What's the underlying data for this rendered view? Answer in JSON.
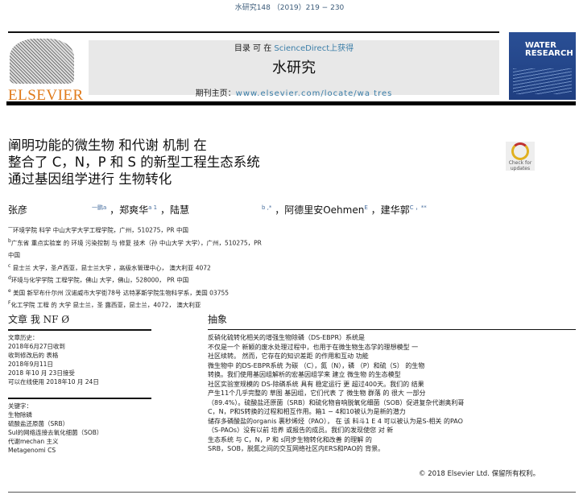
{
  "citation": "水研究148 （2019）219 − 230",
  "header": {
    "available_prefix": "目录 可 在 ",
    "available_link": "ScienceDirect上获得",
    "journal_name": "水研究",
    "homepage_prefix": "期刊主页：",
    "homepage_link": "www.elsevier.com/locate/wa tres",
    "publisher": "ELSEVIER",
    "cover_title": "WATER RESEARCH"
  },
  "crossmark": "Check for updates",
  "title_lines": [
    "阐明功能的微生物 和代谢 机制 在",
    "整合了 C，N，P  和 S   的新型工程生态系统",
    "通过基因组学进行  生物转化"
  ],
  "authors": [
    {
      "name": "张彦",
      "sup": "一鹏a"
    },
    {
      "name": "，郑爽华",
      "sup": "a 1"
    },
    {
      "name": "，陆慧",
      "sup": "b ,*"
    },
    {
      "name": "，阿德里安Oehmen",
      "sup": "E"
    },
    {
      "name": "，建华郭",
      "sup": "C ，**"
    }
  ],
  "affiliations": [
    {
      "sup": "一",
      "text": "环境学院 科学 中山大学大学工程学院，广州，510275，PR 中国"
    },
    {
      "sup": "b",
      "text": "广东省 重点实验室 的 环境 污染控制 与 修复 技术（孙 中山大学 大学），广州，510275，PR"
    },
    {
      "sup": "",
      "text": "中国"
    },
    {
      "sup": "c",
      "text": " 昆士兰 大学，圣卢西亚，昆士兰大学 ，高级水管理中心， 澳大利亚   4072"
    },
    {
      "sup": "d",
      "text": "环境与化学学院 工程学院，佛山 大学，佛山，528000， PR 中国"
    },
    {
      "sup": "e",
      "text": " 美国 新罕布什尔州 汉诺威市大学街78号 达特茅斯学院生物科学系，美国   03755"
    },
    {
      "sup": "F",
      "text": "化工学院 工程 的 大学 昆士兰，圣 露西亚，昆士兰，4072， 澳大利亚"
    }
  ],
  "article_info": {
    "heading": "文章 我 NF  Ø",
    "history_label": "文章历史：",
    "history": [
      "2018年6月27日收到",
      "收到修改后的 表格",
      "2018年9月11日",
      " 2018 年10 月   23日接受",
      "可以在线使用 2018年10 月   24日"
    ],
    "keywords_label": "关键字：",
    "keywords": [
      "生物除磷",
      "硫酸盐还原菌（SRB）",
      "Sul的网络连接去氧化细菌（SOB）",
      "代谢mechan 主义",
      "Metagenomi CS"
    ]
  },
  "abstract": {
    "heading": "抽象",
    "lines": [
      "反硝化硫转化相关的增强生物除磷（DS-EBPR）系统是",
      "不仅是一个 新颖的废水处理过程中，也用于在微生物生态学的理想模型 一",
      "社区续转。 然而，它存在的知识差距 的作用和互动 功能",
      "微生物中 的DS-EBPR系统 为碳 （C），氮（N），磷 （P）和硫（S） 的生物",
      "转换。我们使用基因组解析的宏基因组学来 建立 微生物      的生态模型",
      "社区实验室规模的 DS-除磷系统 具有 稳定运行 更 超过400天。我们的 结果",
      "产生11个几乎完整的 草图 基因组，它们代表 了 微生物 群落    的 很大 一部分",
      "（89.4%）。硫酸盐还原菌（SRB）和硫化物音响脱氧化细菌（SOB）促进复杂代谢奥利哥",
      "C，N，P和S转换的过程和相互作用。箱1 − 4和10被认为是新的潜力",
      "储存多磷酸盐的organis 裹秒烯烃（PAO），  在 该 料斗1 E 4  可以被认为是S-相关 的PAO",
      "（S-PAOs）没有以前 培养 或报告的成员。我们的发现使您 对 新",
      "生态系统 与 C，N，P  和 s同步生物转化和改善 的理解 的",
      "SRB，SOB，脱氮之间的交互网络社区内ERS和PAO的 背景。"
    ],
    "copyright": "© 2018 Elsevier Ltd.  保留所有权利。"
  }
}
